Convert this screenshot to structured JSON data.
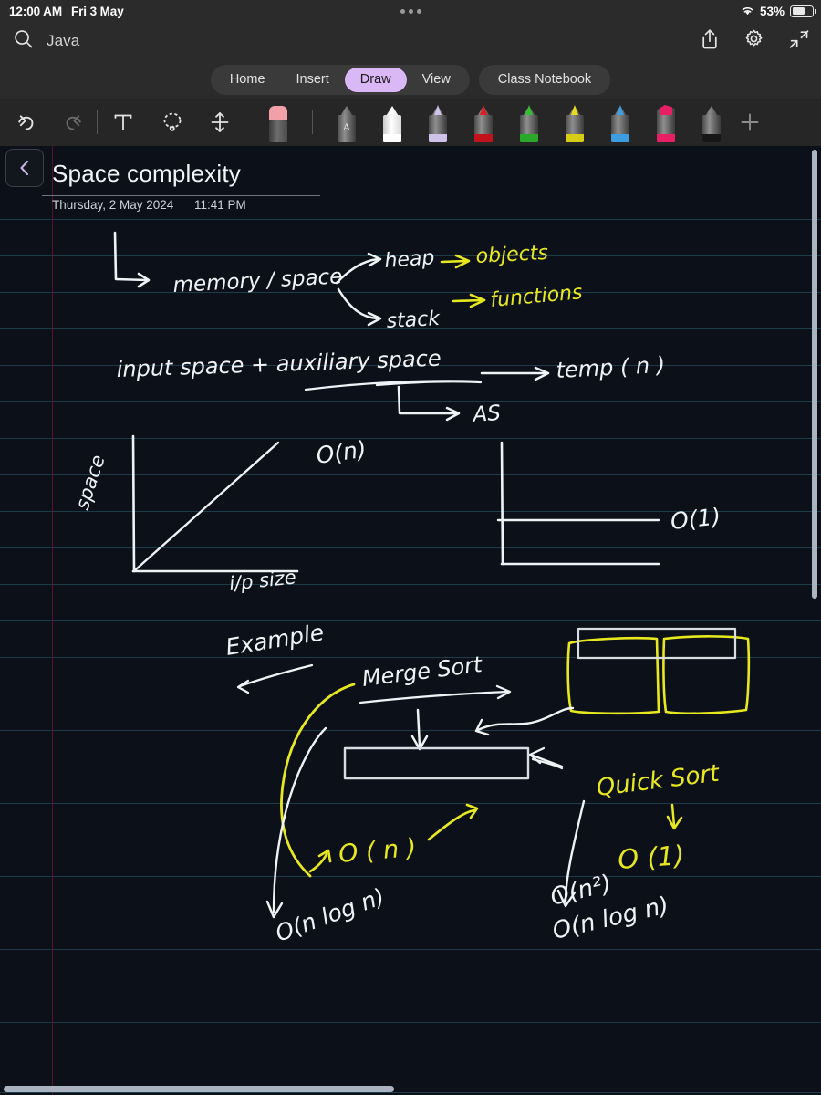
{
  "status_bar": {
    "time": "12:00 AM",
    "date": "Fri 3 May",
    "battery_percent": "53%",
    "wifi_icon": "wifi-icon",
    "battery_icon": "battery-icon",
    "handle_icon": "multitask-handle-icon"
  },
  "app_bar": {
    "search_icon": "search-icon",
    "notebook_name": "Java",
    "share_icon": "share-icon",
    "settings_icon": "gear-icon",
    "collapse_icon": "collapse-icon"
  },
  "ribbon": {
    "tabs": [
      {
        "label": "Home",
        "active": false
      },
      {
        "label": "Insert",
        "active": false
      },
      {
        "label": "Draw",
        "active": true
      },
      {
        "label": "View",
        "active": false
      }
    ],
    "class_notebook_label": "Class Notebook",
    "active_tab_color": "#d9b8f5"
  },
  "toolbar": {
    "undo_icon": "undo-icon",
    "redo_icon": "redo-icon",
    "text_icon": "text-tool-icon",
    "lasso_icon": "lasso-select-icon",
    "insert_space_icon": "insert-space-icon",
    "add_pen_icon": "add-pen-icon",
    "tools": [
      {
        "name": "eraser-tool",
        "color": "#f2a0a8",
        "type": "eraser"
      },
      {
        "name": "pencil-tool",
        "color": "#2f3a44",
        "type": "pencil"
      },
      {
        "name": "pen-white",
        "color": "#ffffff",
        "type": "pen"
      },
      {
        "name": "pen-lavender",
        "color": "#cfc2e8",
        "type": "pen"
      },
      {
        "name": "pen-red",
        "color": "#e01b24",
        "type": "pen"
      },
      {
        "name": "pen-green",
        "color": "#2fbf2f",
        "type": "pen"
      },
      {
        "name": "pen-yellow",
        "color": "#e8dd1d",
        "type": "pen"
      },
      {
        "name": "pen-blue",
        "color": "#3c9ee0",
        "type": "pen"
      },
      {
        "name": "highlighter-pink",
        "color": "#e81f64",
        "type": "marker"
      },
      {
        "name": "pen-black",
        "color": "#171717",
        "type": "pen"
      }
    ]
  },
  "page": {
    "back_icon": "back-chevron-icon",
    "title": "Space complexity",
    "date": "Thursday, 2 May 2024",
    "time": "11:41 PM",
    "background_color": "#0b1019",
    "rule_color": "#1d3b48",
    "margin_color": "#5e1028",
    "vertical_scrollbar": "vertical-scrollbar",
    "horizontal_scrollbar": "horizontal-scrollbar"
  },
  "ink_notes": {
    "ink_colors": {
      "white": "#f0f3f6",
      "yellow": "#e8e81f"
    },
    "line1": {
      "root_arrow": "L-arrow",
      "label": "memory / space",
      "branch_top": "heap",
      "branch_top_result": "objects",
      "branch_bottom": "stack",
      "branch_bottom_result": "functions"
    },
    "line2": {
      "expression": "input space  +  auxiliary space",
      "arrow_result": "temp ( n )",
      "sub_arrow_label": "AS"
    },
    "graph_left": {
      "y_label": "space",
      "x_label": "i/p size",
      "curve_label": "O(n)",
      "curve_type": "linear"
    },
    "graph_right": {
      "curve_label": "O(1)",
      "curve_type": "constant"
    },
    "example_heading": "Example",
    "merge_sort": {
      "title": "Merge Sort",
      "aux_note": "O ( n )",
      "time_note": "O(n log n)"
    },
    "quick_sort": {
      "title": "Quick Sort",
      "aux_note": "O (1)",
      "worst_note": "O(n²)",
      "avg_note": "O(n log n)"
    }
  }
}
